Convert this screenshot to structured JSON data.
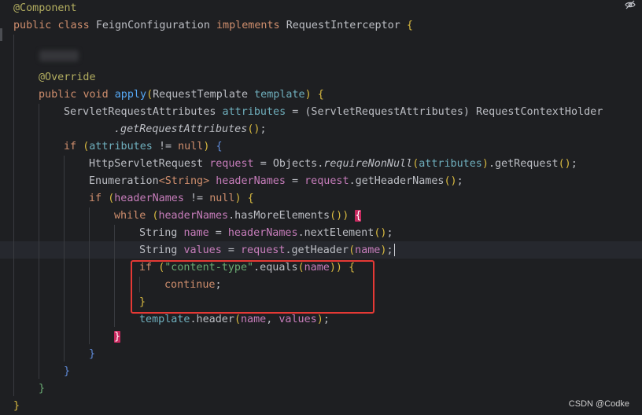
{
  "editor": {
    "lines": {
      "l1": {
        "ann": "@Component"
      },
      "l2": {
        "kw1": "public",
        "kw2": "class",
        "name": "FeignConfiguration",
        "kw3": "implements",
        "iface": "RequestInterceptor",
        "brace": "{"
      },
      "l3": {
        "ann": "@Override"
      },
      "l4": {
        "kw1": "public",
        "kw2": "void",
        "fn": "apply",
        "open": "(",
        "type": "RequestTemplate",
        "param": "template",
        "close": ")",
        "brace": "{"
      },
      "l5": {
        "type": "ServletRequestAttributes",
        "var": "attributes",
        "eq": "=",
        "cast": "(ServletRequestAttributes) RequestContextHolder"
      },
      "l6": {
        "call": ".getRequestAttributes",
        "paren": "()",
        "semi": ";"
      },
      "l7": {
        "kw": "if",
        "open": "(",
        "var": "attributes",
        "op": "!=",
        "null": "null",
        "close": ")",
        "brace": "{"
      },
      "l8": {
        "type": "HttpServletRequest",
        "var": "request",
        "eq": "=",
        "cls": "Objects.",
        "call": "requireNonNull",
        "open": "(",
        "arg": "attributes",
        "close": ")",
        "tail": ".getRequest",
        "paren": "()",
        "semi": ";"
      },
      "l9": {
        "type": "Enumeration",
        "generic": "<String>",
        "var": "headerNames",
        "eq": "=",
        "obj": "request",
        "tail": ".getHeaderNames",
        "paren": "()",
        "semi": ";"
      },
      "l10": {
        "kw": "if",
        "open": "(",
        "var": "headerNames",
        "op": "!=",
        "null": "null",
        "close": ")",
        "brace": "{"
      },
      "l11": {
        "kw": "while",
        "open": "(",
        "var": "headerNames",
        "tail": ".hasMoreElements",
        "paren": "()",
        "close": ")",
        "brace": "{"
      },
      "l12": {
        "type": "String",
        "var": "name",
        "eq": "=",
        "obj": "headerNames",
        "tail": ".nextElement",
        "paren": "()",
        "semi": ";"
      },
      "l13": {
        "type": "String",
        "var": "values",
        "eq": "=",
        "obj": "request",
        "tail": ".getHeader",
        "open": "(",
        "arg": "name",
        "close": ")",
        "semi": ";"
      },
      "l14": {
        "kw": "if",
        "open": "(",
        "str": "\"content-type\"",
        "tail": ".equals",
        "popen": "(",
        "arg": "name",
        "pclose": "))",
        "brace": "{"
      },
      "l15": {
        "kw": "continue",
        "semi": ";"
      },
      "l16": {
        "brace": "}"
      },
      "l17": {
        "obj": "template",
        "tail": ".header",
        "open": "(",
        "arg1": "name",
        "comma": ",",
        "arg2": "values",
        "close": ")",
        "semi": ";"
      },
      "l18": {
        "brace": "}"
      },
      "l19": {
        "brace": "}"
      },
      "l20": {
        "brace": "}"
      },
      "l21": {
        "brace": "}"
      },
      "l22": {
        "brace": "}"
      }
    }
  },
  "watermark": "CSDN @Codke",
  "icons": {
    "reader_mode": "eye-slash-icon"
  },
  "colors": {
    "background": "#1e1f22",
    "keyword": "#cf8e6d",
    "annotation": "#b3ae60",
    "function": "#56a8f5",
    "parameter": "#6fafbd",
    "local": "#c77dbb",
    "string": "#6aab73",
    "highlight_box": "#e53935"
  }
}
